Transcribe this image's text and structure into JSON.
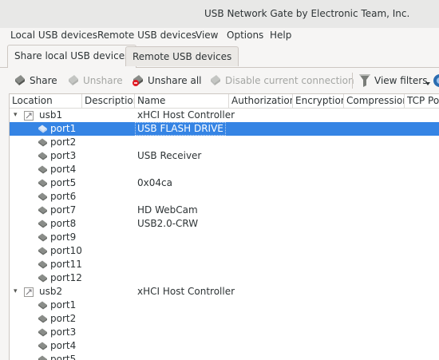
{
  "window": {
    "title": "USB Network Gate by Electronic Team, Inc."
  },
  "menu": [
    "Local USB devices",
    "Remote USB devices",
    "View",
    "Options",
    "Help"
  ],
  "tabs": [
    {
      "label": "Share local USB devices",
      "active": true
    },
    {
      "label": "Remote USB devices",
      "active": false
    }
  ],
  "toolbar": {
    "share": "Share",
    "unshare": "Unshare",
    "unshare_all": "Unshare all",
    "disable_connection": "Disable current connection",
    "view_filters": "View filters"
  },
  "columns": [
    "Location",
    "Description",
    "Name",
    "Authorization",
    "Encryption",
    "Compression",
    "TCP Po"
  ],
  "tree": [
    {
      "location": "usb1",
      "type": "hub",
      "name": "xHCI Host Controller"
    },
    {
      "location": "port1",
      "type": "port",
      "name": "USB FLASH DRIVE",
      "selected": true
    },
    {
      "location": "port2",
      "type": "port",
      "name": ""
    },
    {
      "location": "port3",
      "type": "port",
      "name": "USB Receiver"
    },
    {
      "location": "port4",
      "type": "port",
      "name": ""
    },
    {
      "location": "port5",
      "type": "port",
      "name": "0x04ca"
    },
    {
      "location": "port6",
      "type": "port",
      "name": ""
    },
    {
      "location": "port7",
      "type": "port",
      "name": "HD WebCam"
    },
    {
      "location": "port8",
      "type": "port",
      "name": "USB2.0-CRW"
    },
    {
      "location": "port9",
      "type": "port",
      "name": ""
    },
    {
      "location": "port10",
      "type": "port",
      "name": ""
    },
    {
      "location": "port11",
      "type": "port",
      "name": ""
    },
    {
      "location": "port12",
      "type": "port",
      "name": ""
    },
    {
      "location": "usb2",
      "type": "hub",
      "name": "xHCI Host Controller"
    },
    {
      "location": "port1",
      "type": "port",
      "name": ""
    },
    {
      "location": "port2",
      "type": "port",
      "name": ""
    },
    {
      "location": "port3",
      "type": "port",
      "name": ""
    },
    {
      "location": "port4",
      "type": "port",
      "name": ""
    },
    {
      "location": "port5",
      "type": "port",
      "name": ""
    }
  ],
  "colors": {
    "selection": "#3584e4",
    "window_bg": "#f6f5f4"
  }
}
